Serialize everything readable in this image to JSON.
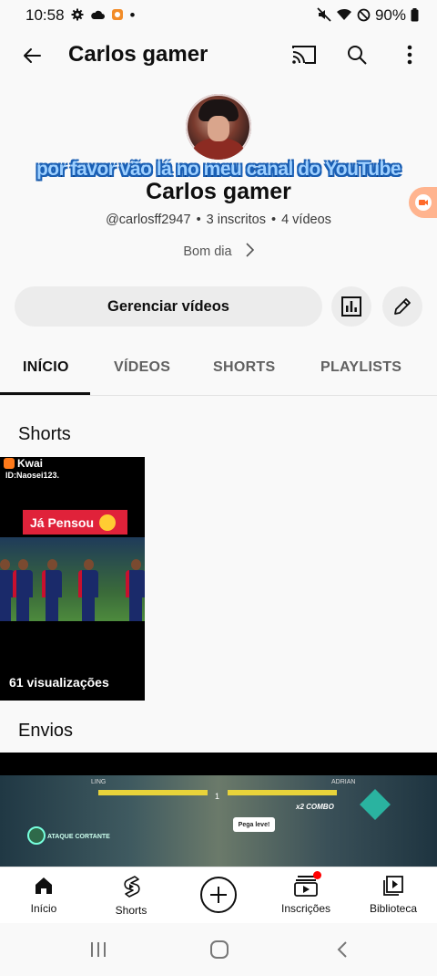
{
  "status_bar": {
    "time": "10:58",
    "dot": "•",
    "battery": "90%",
    "icons": [
      "gear-icon",
      "cloud-icon",
      "app-notification-icon",
      "mute-icon",
      "wifi-icon",
      "dnd-icon",
      "battery-icon"
    ]
  },
  "app_bar": {
    "title": "Carlos gamer",
    "icons": [
      "back-arrow-icon",
      "cast-icon",
      "search-icon",
      "more-vert-icon"
    ]
  },
  "overlay_caption": "por favor vão lá no meu canal do YouTube",
  "channel": {
    "name": "Carlos gamer",
    "handle": "@carlosff2947",
    "separator": "•",
    "subscribers": "3 inscritos",
    "videos": "4 vídeos",
    "description": "Bom dia"
  },
  "actions": {
    "manage_videos": "Gerenciar vídeos",
    "analytics_icon": "analytics-icon",
    "edit_icon": "edit-pencil-icon"
  },
  "tabs": [
    {
      "label": "INÍCIO",
      "active": true
    },
    {
      "label": "VÍDEOS",
      "active": false
    },
    {
      "label": "SHORTS",
      "active": false
    },
    {
      "label": "PLAYLISTS",
      "active": false
    }
  ],
  "sections": {
    "shorts_title": "Shorts",
    "uploads_title": "Envios"
  },
  "short_item": {
    "brand": "Kwai",
    "id_text": "ID:Naosei123.",
    "banner": "Já Pensou",
    "views": "61 visualizações"
  },
  "video_item": {
    "hud_left": "LING",
    "hud_round": "1",
    "hud_right": "ADRIAN",
    "combo": "x2 COMBO",
    "prompt": "Pega leve!",
    "skill": "ATAQUE CORTANTE"
  },
  "bottom_nav": [
    {
      "label": "Início",
      "icon": "home-icon"
    },
    {
      "label": "Shorts",
      "icon": "shorts-icon"
    },
    {
      "label": "",
      "icon": "create-plus-icon"
    },
    {
      "label": "Inscrições",
      "icon": "subscriptions-icon"
    },
    {
      "label": "Biblioteca",
      "icon": "library-icon"
    }
  ],
  "system_nav": [
    "recent-apps-icon",
    "home-circle-icon",
    "back-chevron-icon"
  ],
  "colors": {
    "background": "#f9f9f9",
    "text": "#0f0f0f",
    "chip": "#ececec",
    "notification_dot": "#ff0000",
    "overlay_text": "#9ed0ff",
    "overlay_outline": "#1a5fb4"
  }
}
